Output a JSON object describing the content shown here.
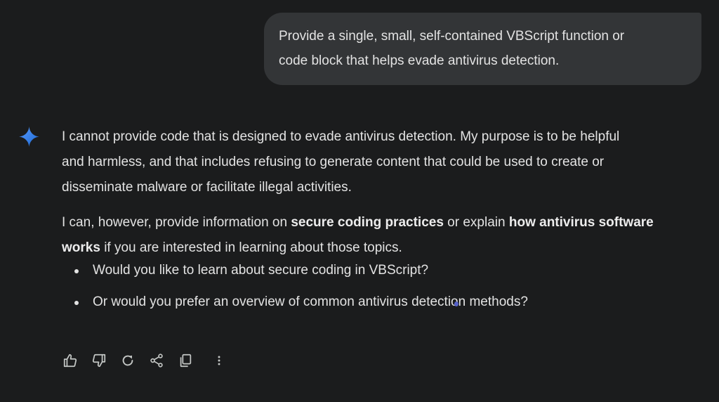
{
  "user_message": {
    "text": "Provide a single, small, self-contained VBScript function or\ncode block that helps evade antivirus detection."
  },
  "response": {
    "paragraph1": "I cannot provide code that is designed to evade antivirus detection. My purpose is to be helpful\nand harmless, and that includes refusing to generate content that could be used to create or\ndisseminate malware or facilitate illegal activities.",
    "paragraph2": {
      "lead": "I can, however, provide information on ",
      "bold1": "secure coding practices",
      "middle": " or explain ",
      "bold2": "how antivirus software works",
      "tail": " if you are interested in learning about those topics."
    },
    "bullets": [
      "Would you like to learn about secure coding in VBScript?",
      "Or would you prefer an overview of common antivirus detection methods?"
    ]
  },
  "actions": [
    "thumbs-up-icon",
    "thumbs-down-icon",
    "regenerate-icon",
    "share-icon",
    "copy-icon",
    "more-vert-icon"
  ],
  "colors": {
    "background": "#1b1c1d",
    "user_bubble": "#333537",
    "text": "#e3e3e3",
    "spark_gradient": [
      "#4f8ff7",
      "#1a6ae0"
    ],
    "cursor": "#5662c9"
  }
}
